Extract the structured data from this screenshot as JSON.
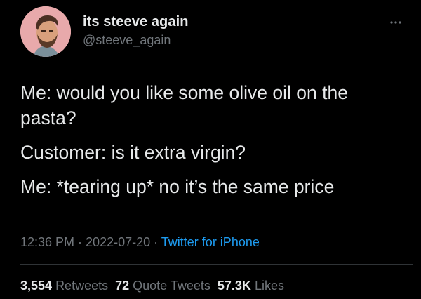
{
  "author": {
    "display_name": "its steeve again",
    "handle": "@steeve_again",
    "avatar_icon": "profile-avatar"
  },
  "more_icon": "more-options-icon",
  "tweet": {
    "paragraphs": [
      "Me: would you like some olive oil on the pasta?",
      "Customer: is it extra virgin?",
      "Me: *tearing up* no it’s the same price"
    ]
  },
  "meta": {
    "time": "12:36 PM",
    "separator": " · ",
    "date": "2022-07-20",
    "source": "Twitter for iPhone"
  },
  "stats": {
    "retweets_count": "3,554",
    "retweets_label": "Retweets",
    "quotes_count": "72",
    "quotes_label": "Quote Tweets",
    "likes_count": "57.3K",
    "likes_label": "Likes"
  },
  "colors": {
    "background": "#000000",
    "text": "#e7e9ea",
    "secondary": "#71767b",
    "link": "#1d9bf0",
    "avatar_bg": "#e8a9ab"
  }
}
